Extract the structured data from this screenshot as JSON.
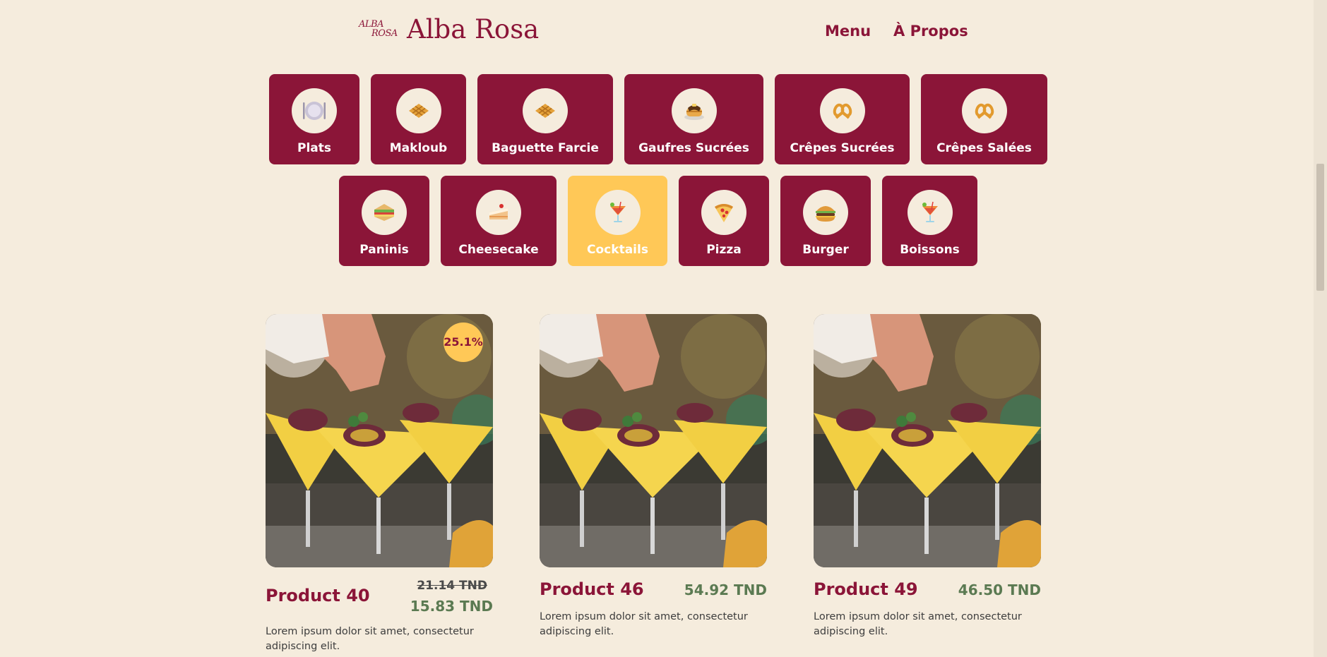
{
  "header": {
    "logo_line1": "ALBA",
    "logo_line2": "ROSA",
    "brand": "Alba Rosa",
    "nav": [
      {
        "label": "Menu"
      },
      {
        "label": "À Propos"
      }
    ]
  },
  "categories": [
    {
      "label": "Plats",
      "icon": "plate-icon"
    },
    {
      "label": "Makloub",
      "icon": "waffle-icon"
    },
    {
      "label": "Baguette Farcie",
      "icon": "waffle-icon"
    },
    {
      "label": "Gaufres Sucrées",
      "icon": "pancakes-icon"
    },
    {
      "label": "Crêpes Sucrées",
      "icon": "pretzel-icon"
    },
    {
      "label": "Crêpes Salées",
      "icon": "pretzel-icon"
    },
    {
      "label": "Paninis",
      "icon": "sandwich-icon"
    },
    {
      "label": "Cheesecake",
      "icon": "cake-icon"
    },
    {
      "label": "Cocktails",
      "icon": "cocktail-icon",
      "active": true
    },
    {
      "label": "Pizza",
      "icon": "pizza-icon"
    },
    {
      "label": "Burger",
      "icon": "burger-icon"
    },
    {
      "label": "Boissons",
      "icon": "cocktail-icon"
    }
  ],
  "products": [
    {
      "name": "Product 40",
      "discount": "25.1%",
      "old_price": "21.14 TND",
      "price": "15.83 TND",
      "description": "Lorem ipsum dolor sit amet, consectetur adipiscing elit."
    },
    {
      "name": "Product 46",
      "price": "54.92 TND",
      "description": "Lorem ipsum dolor sit amet, consectetur adipiscing elit."
    },
    {
      "name": "Product 49",
      "price": "46.50 TND",
      "description": "Lorem ipsum dolor sit amet, consectetur adipiscing elit."
    }
  ],
  "colors": {
    "background": "#f5ecdd",
    "brand": "#8b1538",
    "accent": "#ffc857",
    "price": "#5b7a52"
  }
}
